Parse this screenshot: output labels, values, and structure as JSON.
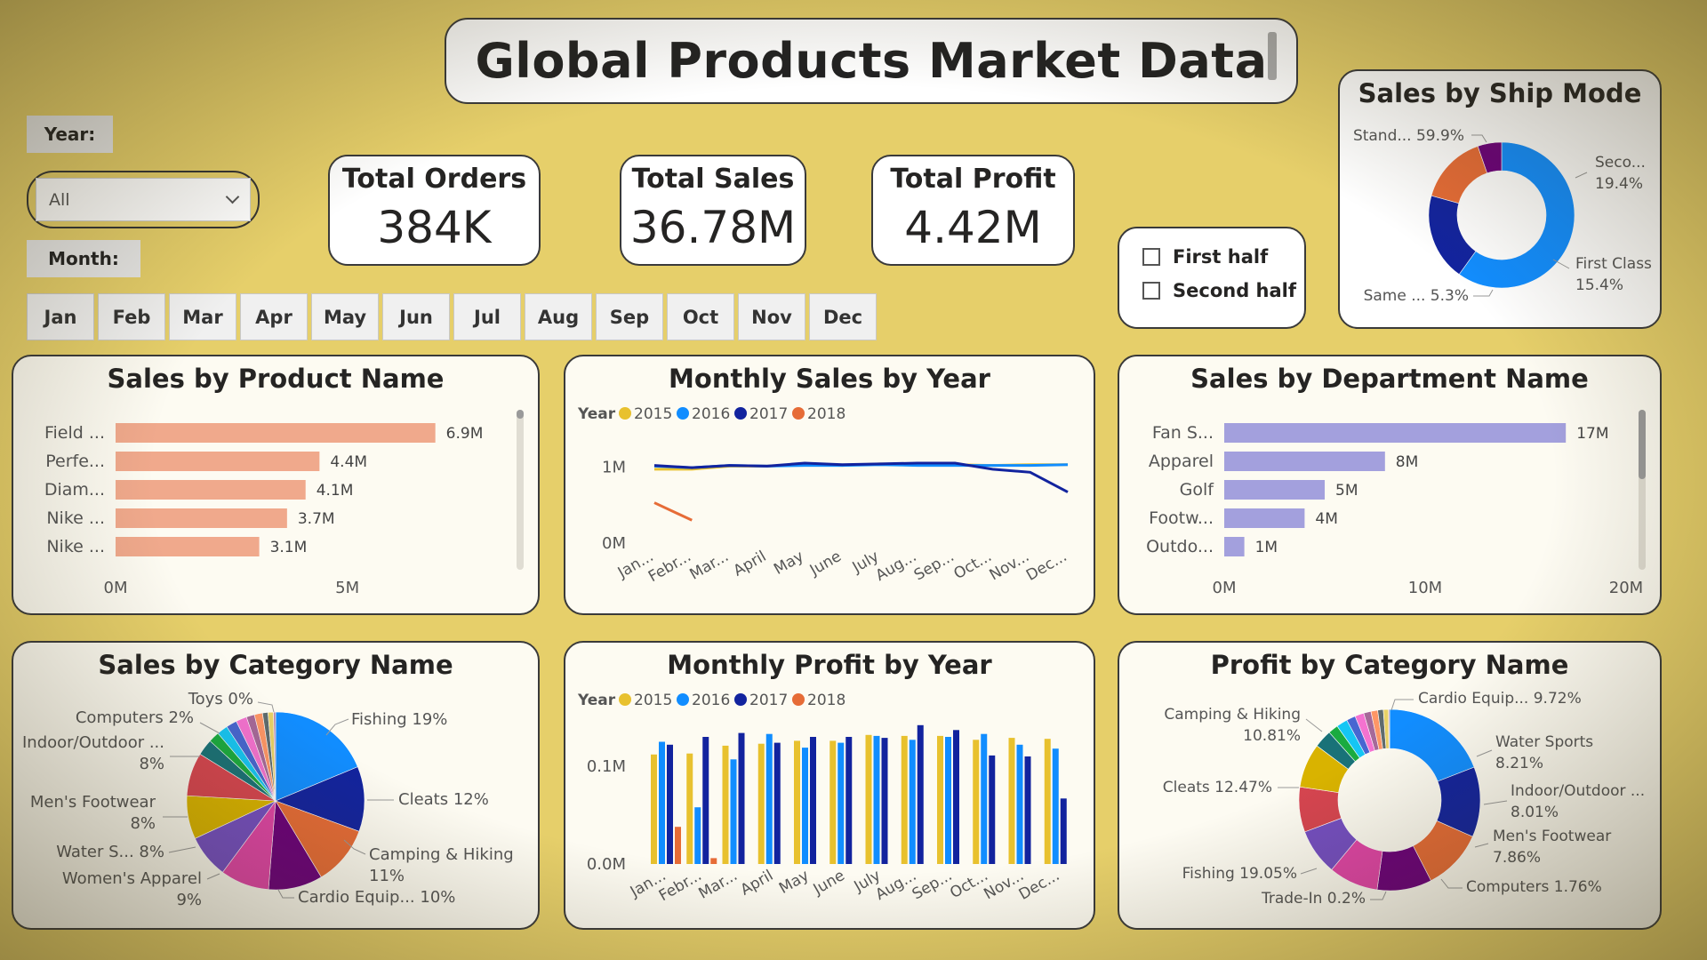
{
  "header": {
    "title": "Global Products Market Data"
  },
  "filters": {
    "year_label": "Year:",
    "year_value": "All",
    "month_label": "Month:",
    "months": [
      "Jan",
      "Feb",
      "Mar",
      "Apr",
      "May",
      "Jun",
      "Jul",
      "Aug",
      "Sep",
      "Oct",
      "Nov",
      "Dec"
    ],
    "halves": [
      "First half",
      "Second half"
    ]
  },
  "kpis": {
    "orders": {
      "label": "Total Orders",
      "value": "384K"
    },
    "sales": {
      "label": "Total Sales",
      "value": "36.78M"
    },
    "profit": {
      "label": "Total Profit",
      "value": "4.42M"
    }
  },
  "colors": {
    "y2015": "#e8c12e",
    "y2016": "#118dff",
    "y2017": "#12239e",
    "y2018": "#e66c37",
    "product_bar": "#f0a98c",
    "dept_bar": "#a3a0dd"
  },
  "chart_data": [
    {
      "id": "ship_mode",
      "type": "pie",
      "donut": true,
      "title": "Sales by Ship Mode",
      "slices": [
        {
          "label": "Stand... 59.9%",
          "value": 59.9,
          "color": "#118dff"
        },
        {
          "label": "Seco... 19.4%",
          "value": 19.4,
          "color": "#12239e"
        },
        {
          "label": "First Class 15.4%",
          "value": 15.4,
          "color": "#e66c37"
        },
        {
          "label": "Same ... 5.3%",
          "value": 5.3,
          "color": "#6b007b"
        }
      ]
    },
    {
      "id": "product",
      "type": "bar",
      "orientation": "horizontal",
      "title": "Sales by Product Name",
      "categories": [
        "Field ...",
        "Perfe...",
        "Diam...",
        "Nike ...",
        "Nike ..."
      ],
      "values": [
        6.9,
        4.4,
        4.1,
        3.7,
        3.1
      ],
      "data_labels": [
        "6.9M",
        "4.4M",
        "4.1M",
        "3.7M",
        "3.1M"
      ],
      "xlim": [
        0,
        8
      ],
      "x_ticks": [
        {
          "v": 0,
          "label": "0M"
        },
        {
          "v": 5,
          "label": "5M"
        }
      ]
    },
    {
      "id": "monthly_sales",
      "type": "line",
      "title": "Monthly Sales by Year",
      "legend_title": "Year",
      "categories": [
        "Jan...",
        "Febr...",
        "Mar...",
        "April",
        "May",
        "June",
        "July",
        "Aug...",
        "Sep...",
        "Oct...",
        "Nov...",
        "Dec..."
      ],
      "ylim": [
        0,
        1.4
      ],
      "y_ticks": [
        {
          "v": 0,
          "label": "0M"
        },
        {
          "v": 1,
          "label": "1M"
        }
      ],
      "series": [
        {
          "name": "2015",
          "values": [
            0.97,
            0.97,
            1.01,
            1.01,
            1.03,
            1.02,
            1.04,
            1.03,
            1.03,
            1.02,
            1.03,
            1.03
          ]
        },
        {
          "name": "2016",
          "values": [
            1.01,
            0.99,
            1.02,
            1.01,
            1.02,
            1.02,
            1.03,
            1.02,
            1.02,
            1.02,
            1.02,
            1.03
          ]
        },
        {
          "name": "2017",
          "values": [
            1.02,
            0.99,
            1.02,
            1.01,
            1.05,
            1.03,
            1.04,
            1.05,
            1.05,
            0.97,
            0.93,
            0.67
          ]
        },
        {
          "name": "2018",
          "values": [
            0.53,
            0.3,
            null,
            null,
            null,
            null,
            null,
            null,
            null,
            null,
            null,
            null
          ]
        }
      ]
    },
    {
      "id": "department",
      "type": "bar",
      "orientation": "horizontal",
      "title": "Sales by Department Name",
      "categories": [
        "Fan S...",
        "Apparel",
        "Golf",
        "Footw...",
        "Outdo..."
      ],
      "values": [
        17,
        8,
        5,
        4,
        1
      ],
      "data_labels": [
        "17M",
        "8M",
        "5M",
        "4M",
        "1M"
      ],
      "xlim": [
        0,
        20
      ],
      "x_ticks": [
        {
          "v": 0,
          "label": "0M"
        },
        {
          "v": 10,
          "label": "10M"
        },
        {
          "v": 20,
          "label": "20M"
        }
      ]
    },
    {
      "id": "category_sales",
      "type": "pie",
      "title": "Sales by Category Name",
      "slices": [
        {
          "label": "Fishing 19%",
          "value": 19,
          "color": "#118dff"
        },
        {
          "label": "Cleats 12%",
          "value": 12,
          "color": "#12239e"
        },
        {
          "label": "Camping & Hiking 11%",
          "value": 11,
          "color": "#e66c37"
        },
        {
          "label": "Cardio Equip... 10%",
          "value": 10,
          "color": "#6b007b"
        },
        {
          "label": "Women's Apparel 9%",
          "value": 9,
          "color": "#e044a7"
        },
        {
          "label": "Water S... 8%",
          "value": 8,
          "color": "#744ec2"
        },
        {
          "label": "Men's Footwear 8%",
          "value": 8,
          "color": "#d9b300"
        },
        {
          "label": "Indoor/Outdoor ... 8%",
          "value": 8,
          "color": "#d64550"
        },
        {
          "label": "",
          "value": 3,
          "color": "#197278"
        },
        {
          "label": "Computers 2%",
          "value": 2,
          "color": "#1aab40"
        },
        {
          "label": "",
          "value": 2,
          "color": "#15c6f4"
        },
        {
          "label": "",
          "value": 2,
          "color": "#4766d1"
        },
        {
          "label": "",
          "value": 2,
          "color": "#f472d0"
        },
        {
          "label": "",
          "value": 1.5,
          "color": "#a66999"
        },
        {
          "label": "",
          "value": 1.5,
          "color": "#fe9666"
        },
        {
          "label": "",
          "value": 1,
          "color": "#5f6b6d"
        },
        {
          "label": "",
          "value": 1,
          "color": "#e8d166"
        },
        {
          "label": "Toys 0%",
          "value": 0.4,
          "color": "#b887ad"
        }
      ]
    },
    {
      "id": "monthly_profit",
      "type": "bar",
      "title": "Monthly Profit by Year",
      "legend_title": "Year",
      "categories": [
        "Jan...",
        "Febr...",
        "Mar...",
        "April",
        "May",
        "June",
        "July",
        "Aug...",
        "Sep...",
        "Oct...",
        "Nov...",
        "Dec..."
      ],
      "ylim": [
        0,
        0.14
      ],
      "y_ticks": [
        {
          "v": 0,
          "label": "0.0M"
        },
        {
          "v": 0.1,
          "label": "0.1M"
        }
      ],
      "series": [
        {
          "name": "2015",
          "values": [
            0.112,
            0.113,
            0.121,
            0.123,
            0.126,
            0.126,
            0.132,
            0.131,
            0.131,
            0.127,
            0.129,
            0.128
          ]
        },
        {
          "name": "2016",
          "values": [
            0.125,
            0.058,
            0.107,
            0.133,
            0.119,
            0.124,
            0.131,
            0.127,
            0.13,
            0.133,
            0.122,
            0.118
          ]
        },
        {
          "name": "2017",
          "values": [
            0.122,
            0.13,
            0.134,
            0.124,
            0.13,
            0.13,
            0.129,
            0.142,
            0.137,
            0.111,
            0.11,
            0.067
          ]
        },
        {
          "name": "2018",
          "values": [
            0.038,
            0.006,
            null,
            null,
            null,
            null,
            null,
            null,
            null,
            null,
            null,
            null
          ]
        }
      ]
    },
    {
      "id": "category_profit",
      "type": "pie",
      "donut": true,
      "title": "Profit by Category Name",
      "slices": [
        {
          "label": "Fishing 19.05%",
          "value": 19.05,
          "color": "#118dff"
        },
        {
          "label": "Cleats 12.47%",
          "value": 12.47,
          "color": "#12239e"
        },
        {
          "label": "Camping & Hiking 10.81%",
          "value": 10.81,
          "color": "#e66c37"
        },
        {
          "label": "Cardio Equip... 9.72%",
          "value": 9.72,
          "color": "#6b007b"
        },
        {
          "label": "",
          "value": 8.8,
          "color": "#e044a7"
        },
        {
          "label": "Water Sports 8.21%",
          "value": 8.21,
          "color": "#744ec2"
        },
        {
          "label": "Indoor/Outdoor ... 8.01%",
          "value": 8.01,
          "color": "#d64550"
        },
        {
          "label": "Men's Footwear 7.86%",
          "value": 7.86,
          "color": "#d9b300"
        },
        {
          "label": "",
          "value": 3.2,
          "color": "#197278"
        },
        {
          "label": "Computers 1.76%",
          "value": 1.76,
          "color": "#1aab40"
        },
        {
          "label": "",
          "value": 2.0,
          "color": "#15c6f4"
        },
        {
          "label": "",
          "value": 1.6,
          "color": "#4766d1"
        },
        {
          "label": "",
          "value": 1.6,
          "color": "#f472d0"
        },
        {
          "label": "",
          "value": 1.3,
          "color": "#a66999"
        },
        {
          "label": "",
          "value": 1.2,
          "color": "#fe9666"
        },
        {
          "label": "",
          "value": 1.0,
          "color": "#5f6b6d"
        },
        {
          "label": "",
          "value": 0.9,
          "color": "#e8d166"
        },
        {
          "label": "Trade-In 0.2%",
          "value": 0.2,
          "color": "#b887ad"
        }
      ]
    }
  ]
}
